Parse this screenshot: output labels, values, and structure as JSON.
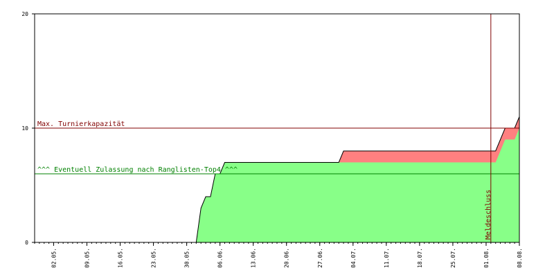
{
  "chart_data": {
    "type": "area",
    "title": "",
    "xlabel": "",
    "ylabel": "",
    "x_start": "2021-04-28",
    "x_end": "2021-08-08",
    "ylim": [
      0,
      20
    ],
    "y_ticks": [
      0,
      10,
      20
    ],
    "x_tick_labels": [
      "02.05.",
      "09.05.",
      "16.05.",
      "23.05.",
      "30.05.",
      "06.06.",
      "13.06.",
      "20.06.",
      "27.06.",
      "04.07.",
      "11.07.",
      "18.07.",
      "25.07.",
      "01.08.",
      "08.08."
    ],
    "x_tick_dates": [
      "2021-05-02",
      "2021-05-09",
      "2021-05-16",
      "2021-05-23",
      "2021-05-30",
      "2021-06-06",
      "2021-06-13",
      "2021-06-20",
      "2021-06-27",
      "2021-07-04",
      "2021-07-11",
      "2021-07-18",
      "2021-07-25",
      "2021-08-01",
      "2021-08-08"
    ],
    "grid": false,
    "series": [
      {
        "color": "#ff8080",
        "points": [
          [
            "2021-04-28",
            0
          ],
          [
            "2021-06-01",
            0
          ],
          [
            "2021-06-02",
            3
          ],
          [
            "2021-06-03",
            4
          ],
          [
            "2021-06-04",
            4
          ],
          [
            "2021-06-05",
            6
          ],
          [
            "2021-06-06",
            6
          ],
          [
            "2021-06-07",
            7
          ],
          [
            "2021-07-01",
            7
          ],
          [
            "2021-07-02",
            8
          ],
          [
            "2021-08-03",
            8
          ],
          [
            "2021-08-05",
            10
          ],
          [
            "2021-08-07",
            10
          ],
          [
            "2021-08-08",
            11
          ]
        ]
      },
      {
        "color": "#88ff88",
        "points": [
          [
            "2021-04-28",
            0
          ],
          [
            "2021-06-01",
            0
          ],
          [
            "2021-06-02",
            3
          ],
          [
            "2021-06-03",
            4
          ],
          [
            "2021-06-04",
            4
          ],
          [
            "2021-06-05",
            6
          ],
          [
            "2021-06-06",
            6
          ],
          [
            "2021-06-07",
            7
          ],
          [
            "2021-08-03",
            7
          ],
          [
            "2021-08-05",
            9
          ],
          [
            "2021-08-07",
            9
          ],
          [
            "2021-08-08",
            10
          ]
        ]
      }
    ],
    "hlines": [
      {
        "label": "Max. Turnierkapazität",
        "y": 10,
        "color": "#800000"
      },
      {
        "label": "^^^ Eventuell Zulassung nach Ranglisten-Top4 ^^^",
        "y": 6,
        "color": "#008000"
      }
    ],
    "vlines": [
      {
        "label": "Meldeschluss",
        "date": "2021-08-02",
        "color": "#800000"
      }
    ]
  }
}
